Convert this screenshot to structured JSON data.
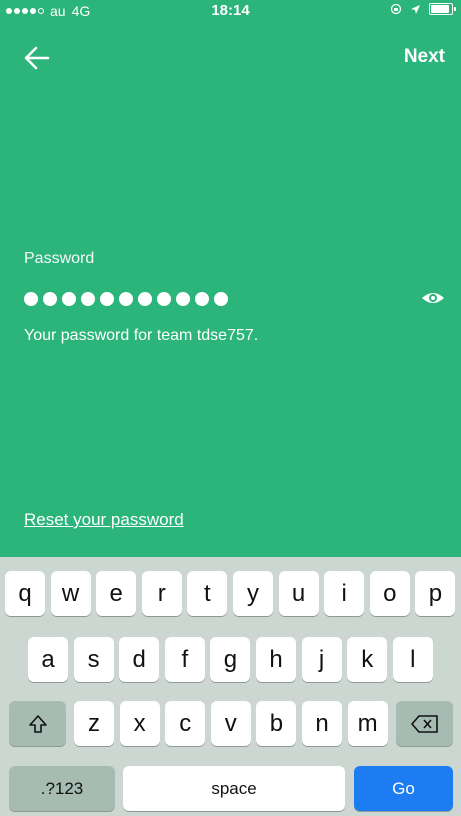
{
  "status_bar": {
    "carrier": "au",
    "network": "4G",
    "time": "18:14"
  },
  "nav": {
    "next_label": "Next"
  },
  "form": {
    "password_label": "Password",
    "password_dot_count": 11,
    "hint": "Your password for team tdse757.",
    "reset_link": "Reset your password"
  },
  "keyboard": {
    "row1": [
      "q",
      "w",
      "e",
      "r",
      "t",
      "y",
      "u",
      "i",
      "o",
      "p"
    ],
    "row2": [
      "a",
      "s",
      "d",
      "f",
      "g",
      "h",
      "j",
      "k",
      "l"
    ],
    "row3": [
      "z",
      "x",
      "c",
      "v",
      "b",
      "n",
      "m"
    ],
    "numbers_label": ".?123",
    "space_label": "space",
    "go_label": "Go"
  },
  "colors": {
    "background": "#2bb57a",
    "keyboard": "#cdd7d2",
    "go_key": "#1d7cf2"
  }
}
